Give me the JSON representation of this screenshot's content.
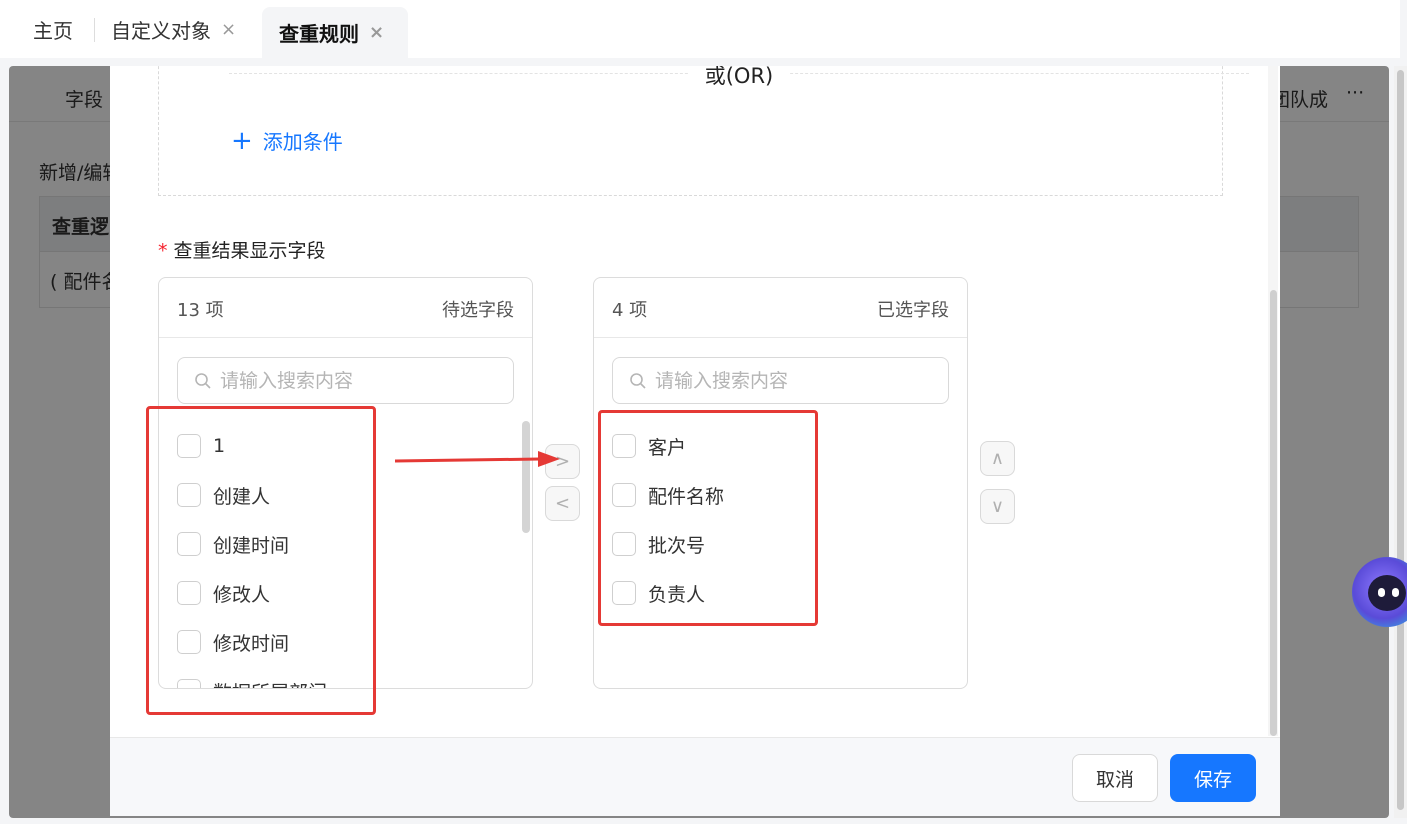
{
  "tabs": {
    "home": "主页",
    "custom_object": "自定义对象",
    "dedupe_rules": "查重规则",
    "close_glyph": "×"
  },
  "background": {
    "tab_fields": "字段",
    "tab_team_fragment": "团队成",
    "more": "···",
    "section_fragment": "新增/编辑",
    "table_header_fragment": "查重逻",
    "table_cell_fragment": "( 配件名"
  },
  "modal": {
    "or_label": "或(OR)",
    "add_condition": "添加条件",
    "add_icon": "+",
    "display_fields_label": "查重结果显示字段",
    "required_mark": "*",
    "left_panel": {
      "count": "13 项",
      "title": "待选字段",
      "search_placeholder": "请输入搜索内容",
      "items": [
        "1",
        "创建人",
        "创建时间",
        "修改人",
        "修改时间",
        "数据所属部门"
      ]
    },
    "right_panel": {
      "count": "4 项",
      "title": "已选字段",
      "search_placeholder": "请输入搜索内容",
      "items": [
        "客户",
        "配件名称",
        "批次号",
        "负责人"
      ]
    },
    "move_right": ">",
    "move_left": "<",
    "move_up": "∧",
    "move_down": "∨",
    "cancel": "取消",
    "save": "保存"
  },
  "colors": {
    "primary": "#1677ff",
    "annotation": "#e53935",
    "required": "#f5222d"
  }
}
